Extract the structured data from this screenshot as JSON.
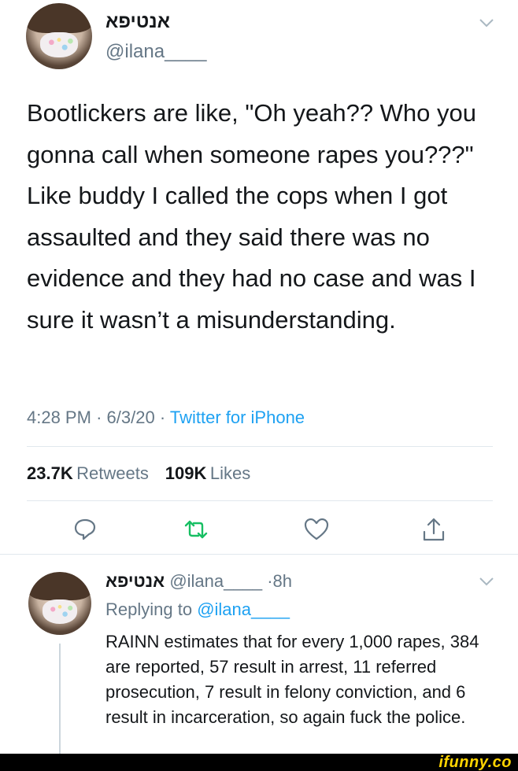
{
  "tweet": {
    "display_name": "אנטיפא",
    "handle": "@ilana____",
    "text": "Bootlickers are like, \"Oh yeah?? Who you gonna call when someone rapes you???\" Like buddy I called the cops when I got assaulted and they said there was no evidence and they had no case and was I sure it wasn’t a misunderstanding.",
    "time": "4:28 PM",
    "date": "6/3/20",
    "source": "Twitter for iPhone",
    "separator": "·",
    "retweets_count": "23.7K",
    "retweets_label": "Retweets",
    "likes_count": "109K",
    "likes_label": "Likes"
  },
  "actions": {
    "reply_icon": "reply-icon",
    "retweet_icon": "retweet-icon",
    "like_icon": "heart-icon",
    "share_icon": "share-icon",
    "retweet_color": "#17bf63"
  },
  "reply": {
    "display_name": "אנטיפא",
    "handle": "@ilana____",
    "age": "8h",
    "separator": "·",
    "replying_prefix": "Replying to",
    "replying_to": "@ilana____",
    "text": "RAINN estimates that for every 1,000 rapes, 384 are reported, 57 result in arrest, 11 referred prosecution, 7 result in felony conviction, and 6 result in incarceration, so again fuck the police."
  },
  "watermark": {
    "text": "ifunny.co"
  },
  "colors": {
    "link": "#1da1f2",
    "muted": "#657786",
    "text": "#14171a"
  }
}
